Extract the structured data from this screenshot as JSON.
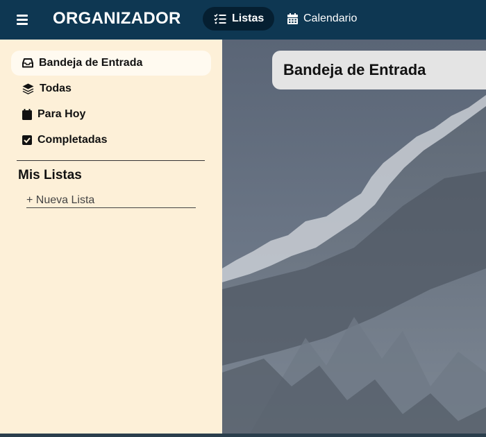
{
  "app": {
    "title": "ORGANIZADOR"
  },
  "nav": {
    "tabs": [
      {
        "label": "Listas",
        "icon": "list-check-icon",
        "active": true
      },
      {
        "label": "Calendario",
        "icon": "calendar-icon",
        "active": false
      }
    ]
  },
  "sidebar": {
    "items": [
      {
        "label": "Bandeja de Entrada",
        "icon": "inbox-icon",
        "active": true
      },
      {
        "label": "Todas",
        "icon": "layers-icon",
        "active": false
      },
      {
        "label": "Para Hoy",
        "icon": "calendar-icon",
        "active": false
      },
      {
        "label": "Completadas",
        "icon": "checkbox-icon",
        "active": false
      }
    ],
    "lists_heading": "Mis Listas",
    "new_list_placeholder": "+ Nueva Lista"
  },
  "main": {
    "title": "Bandeja de Entrada"
  },
  "colors": {
    "topbar": "#0e3752",
    "sidebar": "#fdf0d8",
    "active_tab": "#051f31"
  }
}
